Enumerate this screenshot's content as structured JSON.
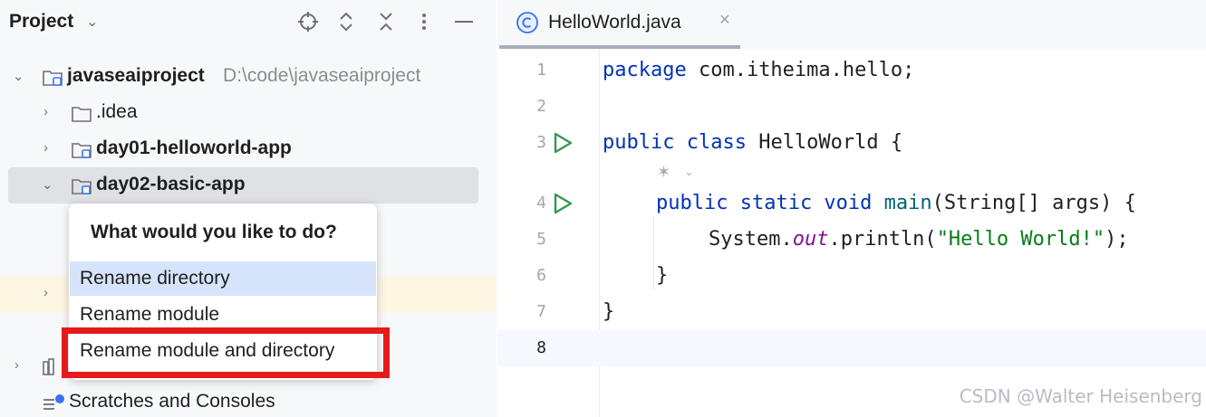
{
  "project_panel": {
    "title": "Project",
    "tree": {
      "root_name": "javaseaiproject",
      "root_path": "D:\\code\\javaseaiproject",
      "idea": ".idea",
      "day01": "day01-helloworld-app",
      "day02": "day02-basic-app",
      "scratches": "Scratches and Consoles"
    }
  },
  "popup": {
    "title": "What would you like to do?",
    "options": [
      "Rename directory",
      "Rename module",
      "Rename module and directory"
    ]
  },
  "editor": {
    "tab_label": "HelloWorld.java",
    "line_numbers": [
      "1",
      "2",
      "3",
      "4",
      "5",
      "6",
      "7",
      "8"
    ],
    "code": {
      "l1_kw": "package",
      "l1_rest": " com.itheima.hello;",
      "l3_kw": "public class",
      "l3_rest": " HelloWorld {",
      "l4_kw": "public static void",
      "l4_fn": " main",
      "l4_rest": "(String[] args) {",
      "l5_obj": "System.",
      "l5_field": "out",
      "l5_call": ".println(",
      "l5_str": "\"Hello World!\"",
      "l5_end": ");",
      "l6": "}",
      "l7": "}"
    }
  },
  "watermark": "CSDN @Walter Heisenberg",
  "colors": {
    "selection": "#dfe1e5",
    "popup_active": "#d6e4fb",
    "highlight_box": "#e51b1b",
    "keyword": "#0033b3",
    "string": "#067d17",
    "run_icon": "#369650"
  }
}
